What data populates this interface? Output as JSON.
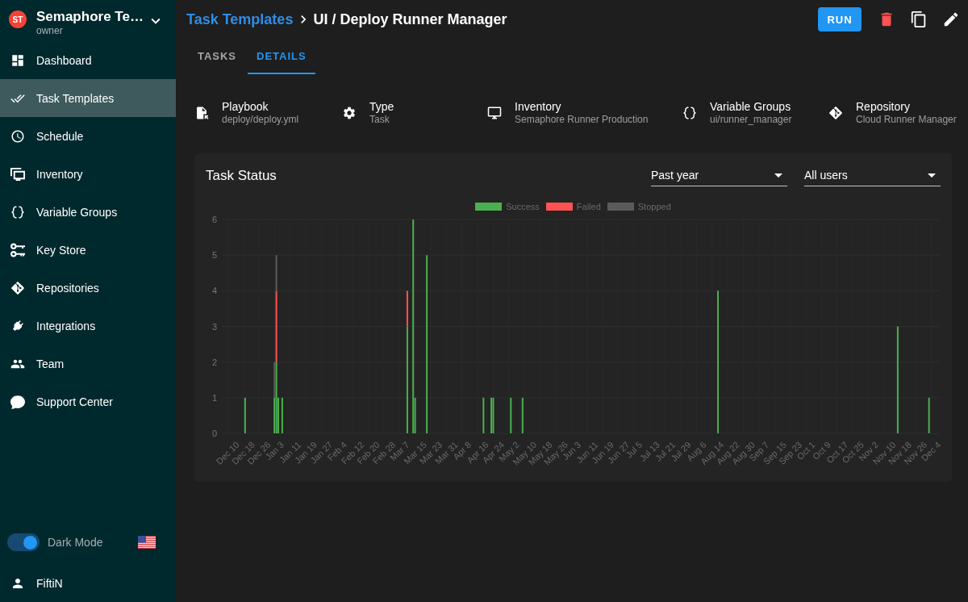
{
  "sidebar": {
    "project": {
      "initials": "ST",
      "name": "Semaphore Te…",
      "role": "owner"
    },
    "items": [
      {
        "label": "Dashboard",
        "selected": false
      },
      {
        "label": "Task Templates",
        "selected": true
      },
      {
        "label": "Schedule",
        "selected": false
      },
      {
        "label": "Inventory",
        "selected": false
      },
      {
        "label": "Variable Groups",
        "selected": false
      },
      {
        "label": "Key Store",
        "selected": false
      },
      {
        "label": "Repositories",
        "selected": false
      },
      {
        "label": "Integrations",
        "selected": false
      },
      {
        "label": "Team",
        "selected": false
      },
      {
        "label": "Support Center",
        "selected": false
      }
    ],
    "dark_mode": {
      "label": "Dark Mode",
      "on": true
    },
    "user": {
      "name": "FiftiN"
    }
  },
  "header": {
    "breadcrumb": "Task Templates",
    "title": "UI / Deploy Runner Manager",
    "run_button": "RUN"
  },
  "tabs": [
    {
      "label": "TASKS",
      "selected": false
    },
    {
      "label": "DETAILS",
      "selected": true
    }
  ],
  "details": [
    {
      "label": "Playbook",
      "value": "deploy/deploy.yml"
    },
    {
      "label": "Type",
      "value": "Task"
    },
    {
      "label": "Inventory",
      "value": "Semaphore Runner Production"
    },
    {
      "label": "Variable Groups",
      "value": "ui/runner_manager"
    },
    {
      "label": "Repository",
      "value": "Cloud Runner Manager"
    }
  ],
  "task_status": {
    "title": "Task Status",
    "period": {
      "value": "Past year"
    },
    "user_filter": {
      "value": "All users"
    },
    "chart_data": {
      "type": "bar",
      "stacked": true,
      "grid": true,
      "legend": "top",
      "categories": [
        null,
        null,
        "Dec 10",
        null,
        null,
        null,
        null,
        null,
        null,
        null,
        "Dec 18",
        null,
        null,
        null,
        null,
        null,
        null,
        null,
        "Dec 26",
        null,
        null,
        null,
        null,
        null,
        null,
        null,
        "Jan 3",
        null,
        null,
        null,
        null,
        null,
        null,
        null,
        "Jan 11",
        null,
        null,
        null,
        null,
        null,
        null,
        null,
        "Jan 19",
        null,
        null,
        null,
        null,
        null,
        null,
        null,
        "Jan 27",
        null,
        null,
        null,
        null,
        null,
        null,
        null,
        "Feb 4",
        null,
        null,
        null,
        null,
        null,
        null,
        null,
        "Feb 12",
        null,
        null,
        null,
        null,
        null,
        null,
        null,
        "Feb 20",
        null,
        null,
        null,
        null,
        null,
        null,
        null,
        "Feb 28",
        null,
        null,
        null,
        null,
        null,
        null,
        null,
        "Mar 7",
        null,
        null,
        null,
        null,
        null,
        null,
        null,
        "Mar 15",
        null,
        null,
        null,
        null,
        null,
        null,
        null,
        "Mar 23",
        null,
        null,
        null,
        null,
        null,
        null,
        null,
        "Mar 31",
        null,
        null,
        null,
        null,
        null,
        null,
        null,
        "Apr 8",
        null,
        null,
        null,
        null,
        null,
        null,
        null,
        "Apr 16",
        null,
        null,
        null,
        null,
        null,
        null,
        null,
        "Apr 24",
        null,
        null,
        null,
        null,
        null,
        null,
        null,
        "May 2",
        null,
        null,
        null,
        null,
        null,
        null,
        null,
        "May 10",
        null,
        null,
        null,
        null,
        null,
        null,
        null,
        "May 18",
        null,
        null,
        null,
        null,
        null,
        null,
        null,
        "May 26",
        null,
        null,
        null,
        null,
        null,
        null,
        null,
        "Jun 3",
        null,
        null,
        null,
        null,
        null,
        null,
        null,
        "Jun 11",
        null,
        null,
        null,
        null,
        null,
        null,
        null,
        "Jun 19",
        null,
        null,
        null,
        null,
        null,
        null,
        null,
        "Jun 27",
        null,
        null,
        null,
        null,
        null,
        null,
        null,
        "Jul 5",
        null,
        null,
        null,
        null,
        null,
        null,
        null,
        "Jul 13",
        null,
        null,
        null,
        null,
        null,
        null,
        null,
        "Jul 21",
        null,
        null,
        null,
        null,
        null,
        null,
        null,
        "Jul 29",
        null,
        null,
        null,
        null,
        null,
        null,
        null,
        "Aug 6",
        null,
        null,
        null,
        null,
        null,
        null,
        null,
        "Aug 14",
        null,
        null,
        null,
        null,
        null,
        null,
        null,
        "Aug 22",
        null,
        null,
        null,
        null,
        null,
        null,
        null,
        "Aug 30",
        null,
        null,
        null,
        null,
        null,
        null,
        null,
        "Sep 7",
        null,
        null,
        null,
        null,
        null,
        null,
        null,
        "Sep 15",
        null,
        null,
        null,
        null,
        null,
        null,
        null,
        "Sep 23",
        null,
        null,
        null,
        null,
        null,
        null,
        null,
        "Oct 1",
        null,
        null,
        null,
        null,
        null,
        null,
        null,
        "Oct 9",
        null,
        null,
        null,
        null,
        null,
        null,
        null,
        "Oct 17",
        null,
        null,
        null,
        null,
        null,
        null,
        null,
        "Oct 25",
        null,
        null,
        null,
        null,
        null,
        null,
        null,
        "Nov 2",
        null,
        null,
        null,
        null,
        null,
        null,
        null,
        "Nov 10",
        null,
        null,
        null,
        null,
        null,
        null,
        null,
        "Nov 18",
        null,
        null,
        null,
        null,
        null,
        null,
        null,
        "Nov 26",
        null,
        null,
        null,
        null,
        null,
        null,
        null,
        "Dec 4",
        null,
        null,
        null,
        null
      ],
      "series": [
        {
          "name": "Success",
          "color": "#4caf50",
          "values": [
            0,
            0,
            0,
            0,
            0,
            0,
            0,
            0,
            0,
            0,
            0,
            1,
            0,
            0,
            0,
            0,
            0,
            0,
            0,
            0,
            0,
            0,
            0,
            0,
            0,
            0,
            1,
            2,
            1,
            0,
            1,
            0,
            0,
            0,
            0,
            0,
            0,
            0,
            0,
            0,
            0,
            0,
            0,
            0,
            0,
            0,
            0,
            0,
            0,
            0,
            0,
            0,
            0,
            0,
            0,
            0,
            0,
            0,
            0,
            0,
            0,
            0,
            0,
            0,
            0,
            0,
            0,
            0,
            0,
            0,
            0,
            0,
            0,
            0,
            0,
            0,
            0,
            0,
            0,
            0,
            0,
            0,
            0,
            0,
            0,
            0,
            0,
            0,
            0,
            0,
            0,
            0,
            0,
            0,
            3,
            0,
            0,
            6,
            1,
            0,
            0,
            0,
            0,
            0,
            5,
            0,
            0,
            0,
            0,
            0,
            0,
            0,
            0,
            0,
            0,
            0,
            0,
            0,
            0,
            0,
            0,
            0,
            0,
            0,
            0,
            0,
            0,
            0,
            0,
            0,
            0,
            0,
            0,
            1,
            0,
            0,
            0,
            1,
            1,
            0,
            0,
            0,
            0,
            0,
            0,
            0,
            0,
            1,
            0,
            0,
            0,
            0,
            0,
            1,
            0,
            0,
            0,
            0,
            0,
            0,
            0,
            0,
            0,
            0,
            0,
            0,
            0,
            0,
            0,
            0,
            0,
            0,
            0,
            0,
            0,
            0,
            0,
            0,
            0,
            0,
            0,
            0,
            0,
            0,
            0,
            0,
            0,
            0,
            0,
            0,
            0,
            0,
            0,
            0,
            0,
            0,
            0,
            0,
            0,
            0,
            0,
            0,
            0,
            0,
            0,
            0,
            0,
            0,
            0,
            0,
            0,
            0,
            0,
            0,
            0,
            0,
            0,
            0,
            0,
            0,
            0,
            0,
            0,
            0,
            0,
            0,
            0,
            0,
            0,
            0,
            0,
            0,
            0,
            0,
            0,
            0,
            0,
            0,
            0,
            0,
            0,
            0,
            0,
            0,
            0,
            0,
            0,
            0,
            0,
            0,
            0,
            0,
            0,
            4,
            0,
            0,
            0,
            0,
            0,
            0,
            0,
            0,
            0,
            0,
            0,
            0,
            0,
            0,
            0,
            0,
            0,
            0,
            0,
            0,
            0,
            0,
            0,
            0,
            0,
            0,
            0,
            0,
            0,
            0,
            0,
            0,
            0,
            0,
            0,
            0,
            0,
            0,
            0,
            0,
            0,
            0,
            0,
            0,
            0,
            0,
            0,
            0,
            0,
            0,
            0,
            0,
            0,
            0,
            0,
            0,
            0,
            0,
            0,
            0,
            0,
            0,
            0,
            0,
            0,
            0,
            0,
            0,
            0,
            0,
            0,
            0,
            0,
            0,
            0,
            0,
            0,
            0,
            0,
            0,
            0,
            0,
            0,
            0,
            0,
            0,
            0,
            0,
            0,
            0,
            0,
            3,
            0,
            0,
            0,
            0,
            0,
            0,
            0,
            0,
            0,
            0,
            0,
            0,
            0,
            0,
            0,
            1,
            0,
            0,
            0,
            0,
            0
          ]
        },
        {
          "name": "Failed",
          "color": "#ff5252",
          "values": [
            0,
            0,
            0,
            0,
            0,
            0,
            0,
            0,
            0,
            0,
            0,
            0,
            0,
            0,
            0,
            0,
            0,
            0,
            0,
            0,
            0,
            0,
            0,
            0,
            0,
            0,
            0,
            2,
            0,
            0,
            0,
            0,
            0,
            0,
            0,
            0,
            0,
            0,
            0,
            0,
            0,
            0,
            0,
            0,
            0,
            0,
            0,
            0,
            0,
            0,
            0,
            0,
            0,
            0,
            0,
            0,
            0,
            0,
            0,
            0,
            0,
            0,
            0,
            0,
            0,
            0,
            0,
            0,
            0,
            0,
            0,
            0,
            0,
            0,
            0,
            0,
            0,
            0,
            0,
            0,
            0,
            0,
            0,
            0,
            0,
            0,
            0,
            0,
            0,
            0,
            0,
            0,
            0,
            0,
            1,
            0,
            0,
            0,
            0,
            0,
            0,
            0,
            0,
            0,
            0,
            0,
            0,
            0,
            0,
            0,
            0,
            0,
            0,
            0,
            0,
            0,
            0,
            0,
            0,
            0,
            0,
            0,
            0,
            0,
            0,
            0,
            0,
            0,
            0,
            0,
            0,
            0,
            0,
            0,
            0,
            0,
            0,
            0,
            0,
            0,
            0,
            0,
            0,
            0,
            0,
            0,
            0,
            0,
            0,
            0,
            0,
            0,
            0,
            0,
            0,
            0,
            0,
            0,
            0,
            0,
            0,
            0,
            0,
            0,
            0,
            0,
            0,
            0,
            0,
            0,
            0,
            0,
            0,
            0,
            0,
            0,
            0,
            0,
            0,
            0,
            0,
            0,
            0,
            0,
            0,
            0,
            0,
            0,
            0,
            0,
            0,
            0,
            0,
            0,
            0,
            0,
            0,
            0,
            0,
            0,
            0,
            0,
            0,
            0,
            0,
            0,
            0,
            0,
            0,
            0,
            0,
            0,
            0,
            0,
            0,
            0,
            0,
            0,
            0,
            0,
            0,
            0,
            0,
            0,
            0,
            0,
            0,
            0,
            0,
            0,
            0,
            0,
            0,
            0,
            0,
            0,
            0,
            0,
            0,
            0,
            0,
            0,
            0,
            0,
            0,
            0,
            0,
            0,
            0,
            0,
            0,
            0,
            0,
            0,
            0,
            0,
            0,
            0,
            0,
            0,
            0,
            0,
            0,
            0,
            0,
            0,
            0,
            0,
            0,
            0,
            0,
            0,
            0,
            0,
            0,
            0,
            0,
            0,
            0,
            0,
            0,
            0,
            0,
            0,
            0,
            0,
            0,
            0,
            0,
            0,
            0,
            0,
            0,
            0,
            0,
            0,
            0,
            0,
            0,
            0,
            0,
            0,
            0,
            0,
            0,
            0,
            0,
            0,
            0,
            0,
            0,
            0,
            0,
            0,
            0,
            0,
            0,
            0,
            0,
            0,
            0,
            0,
            0,
            0,
            0,
            0,
            0,
            0,
            0,
            0,
            0,
            0,
            0,
            0,
            0,
            0,
            0,
            0,
            0,
            0,
            0,
            0,
            0,
            0,
            0,
            0,
            0,
            0,
            0,
            0,
            0,
            0,
            0,
            0,
            0,
            0,
            0,
            0,
            0,
            0,
            0,
            0,
            0,
            0,
            0,
            0,
            0
          ]
        },
        {
          "name": "Stopped",
          "color": "#5a5a5a",
          "values": [
            0,
            0,
            0,
            0,
            0,
            0,
            0,
            0,
            0,
            0,
            0,
            0,
            0,
            0,
            0,
            0,
            0,
            0,
            0,
            0,
            0,
            0,
            0,
            0,
            0,
            0,
            1,
            1,
            0,
            0,
            0,
            0,
            0,
            0,
            0,
            0,
            0,
            0,
            0,
            0,
            0,
            0,
            0,
            0,
            0,
            0,
            0,
            0,
            0,
            0,
            0,
            0,
            0,
            0,
            0,
            0,
            0,
            0,
            0,
            0,
            0,
            0,
            0,
            0,
            0,
            0,
            0,
            0,
            0,
            0,
            0,
            0,
            0,
            0,
            0,
            0,
            0,
            0,
            0,
            0,
            0,
            0,
            0,
            0,
            0,
            0,
            0,
            0,
            0,
            0,
            0,
            0,
            0,
            0,
            0,
            0,
            0,
            0,
            0,
            0,
            0,
            0,
            0,
            0,
            0,
            0,
            0,
            0,
            0,
            0,
            0,
            0,
            0,
            0,
            0,
            0,
            0,
            0,
            0,
            0,
            0,
            0,
            0,
            0,
            0,
            0,
            0,
            0,
            0,
            0,
            0,
            0,
            0,
            0,
            0,
            0,
            0,
            0,
            0,
            0,
            0,
            0,
            0,
            0,
            0,
            0,
            0,
            0,
            0,
            0,
            0,
            0,
            0,
            0,
            0,
            0,
            0,
            0,
            0,
            0,
            0,
            0,
            0,
            0,
            0,
            0,
            0,
            0,
            0,
            0,
            0,
            0,
            0,
            0,
            0,
            0,
            0,
            0,
            0,
            0,
            0,
            0,
            0,
            0,
            0,
            0,
            0,
            0,
            0,
            0,
            0,
            0,
            0,
            0,
            0,
            0,
            0,
            0,
            0,
            0,
            0,
            0,
            0,
            0,
            0,
            0,
            0,
            0,
            0,
            0,
            0,
            0,
            0,
            0,
            0,
            0,
            0,
            0,
            0,
            0,
            0,
            0,
            0,
            0,
            0,
            0,
            0,
            0,
            0,
            0,
            0,
            0,
            0,
            0,
            0,
            0,
            0,
            0,
            0,
            0,
            0,
            0,
            0,
            0,
            0,
            0,
            0,
            0,
            0,
            0,
            0,
            0,
            0,
            0,
            0,
            0,
            0,
            0,
            0,
            0,
            0,
            0,
            0,
            0,
            0,
            0,
            0,
            0,
            0,
            0,
            0,
            0,
            0,
            0,
            0,
            0,
            0,
            0,
            0,
            0,
            0,
            0,
            0,
            0,
            0,
            0,
            0,
            0,
            0,
            0,
            0,
            0,
            0,
            0,
            0,
            0,
            0,
            0,
            0,
            0,
            0,
            0,
            0,
            0,
            0,
            0,
            0,
            0,
            0,
            0,
            0,
            0,
            0,
            0,
            0,
            0,
            0,
            0,
            0,
            0,
            0,
            0,
            0,
            0,
            0,
            0,
            0,
            0,
            0,
            0,
            0,
            0,
            0,
            0,
            0,
            0,
            0,
            0,
            0,
            0,
            0,
            0,
            0,
            0,
            0,
            0,
            0,
            0,
            0,
            0,
            0,
            0,
            0,
            0,
            0,
            0,
            0,
            0,
            0,
            0,
            0,
            0,
            0,
            0,
            0,
            0,
            0
          ]
        }
      ],
      "ylim": [
        0,
        6
      ],
      "yticks": [
        0,
        1,
        2,
        3,
        4,
        5,
        6
      ]
    }
  }
}
